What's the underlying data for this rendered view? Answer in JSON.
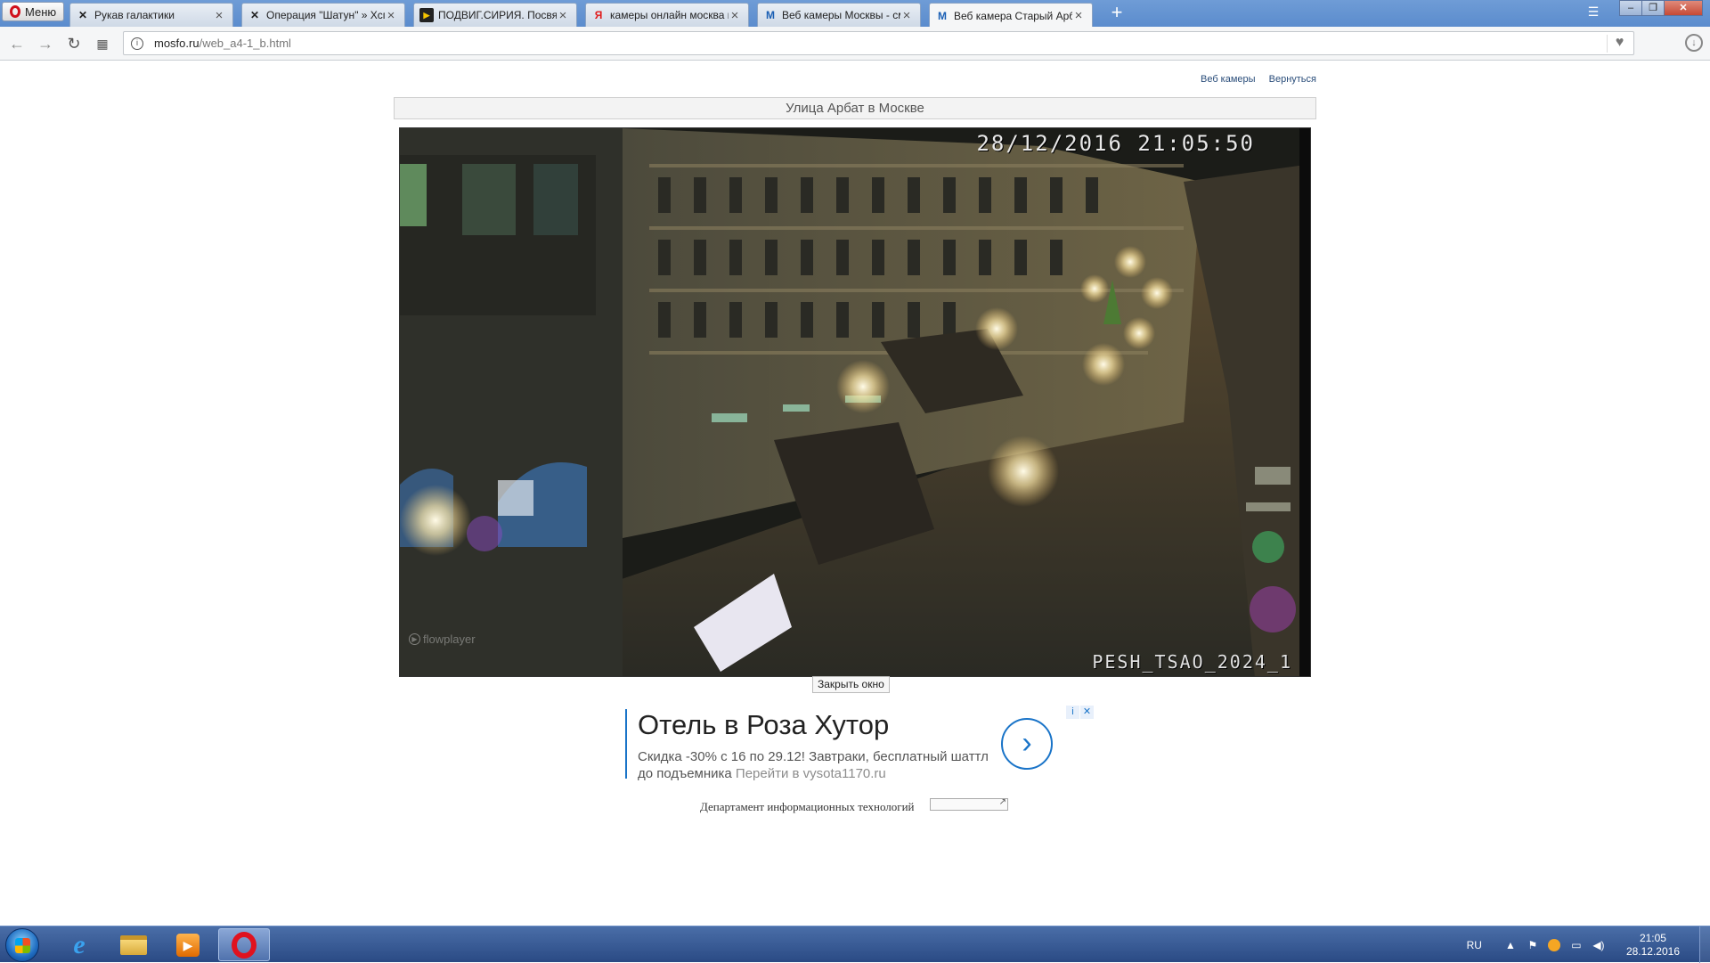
{
  "browser": {
    "menu_label": "Меню",
    "tabs": [
      {
        "title": "Рукав галактики",
        "icon": "wolf-icon",
        "active": false
      },
      {
        "title": "Операция \"Шатун\" » Хсгл",
        "icon": "wolf-icon",
        "active": false
      },
      {
        "title": "ПОДВИГ.СИРИЯ. Посвяще",
        "icon": "play-icon",
        "active": false
      },
      {
        "title": "камеры онлайн москва в",
        "icon": "yandex-icon",
        "active": false
      },
      {
        "title": "Веб камеры Москвы - см",
        "icon": "m-logo-icon",
        "active": false
      },
      {
        "title": "Веб камера Старый Арбат",
        "icon": "m-logo-icon",
        "active": true
      }
    ],
    "url_host": "mosfo.ru",
    "url_path": "/web_a4-1_b.html"
  },
  "page": {
    "links": [
      "Веб камеры",
      "Вернуться"
    ],
    "title": "Улица Арбат в Москве",
    "video": {
      "timestamp": "28/12/2016 21:05:50",
      "camera_id": "PESH_TSAO_2024_1",
      "watermark": "flowplayer"
    },
    "close_button": "Закрыть окно",
    "ad": {
      "title": "Отель в Роза Хутор",
      "text": "Скидка -30% с 16 по 29.12! Завтраки, бесплатный шаттл до подъемника",
      "link": "Перейти в vysota1170.ru",
      "arrow": "›",
      "info": "i",
      "close": "✕"
    },
    "footer": "Департамент информационных технологий"
  },
  "taskbar": {
    "lang": "RU",
    "time": "21:05",
    "date": "28.12.2016"
  }
}
